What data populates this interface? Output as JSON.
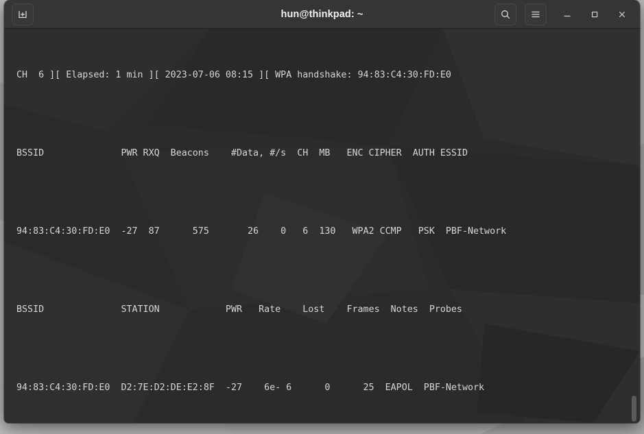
{
  "window": {
    "title": "hun@thinkpad: ~",
    "titlebar": {
      "new_tab_label": "new-tab",
      "search_label": "search",
      "menu_label": "menu",
      "minimize_label": "minimize",
      "maximize_label": "maximize",
      "close_label": "close"
    },
    "colors": {
      "titlebar_bg": "#353535",
      "terminal_bg": "#2b2b2b",
      "terminal_fg": "#d6d6d6",
      "desktop_bg": "#b7b7b7",
      "scrollbar_thumb": "#5a5a5a"
    }
  },
  "terminal": {
    "status_line": {
      "channel_label": "CH",
      "channel": "6",
      "elapsed_label": "Elapsed:",
      "elapsed": "1 min",
      "timestamp": "2023-07-06 08:15",
      "handshake_label": "WPA handshake:",
      "handshake_bssid": "94:83:C4:30:FD:E0",
      "text": "CH  6 ][ Elapsed: 1 min ][ 2023-07-06 08:15 ][ WPA handshake: 94:83:C4:30:FD:E0"
    },
    "ap_table": {
      "header": "BSSID              PWR RXQ  Beacons    #Data, #/s  CH  MB   ENC CIPHER  AUTH ESSID",
      "columns": [
        "BSSID",
        "PWR",
        "RXQ",
        "Beacons",
        "#Data,",
        "#/s",
        "CH",
        "MB",
        "ENC",
        "CIPHER",
        "AUTH",
        "ESSID"
      ],
      "rows": [
        {
          "line": "94:83:C4:30:FD:E0  -27  87      575       26    0   6  130   WPA2 CCMP   PSK  PBF-Network",
          "bssid": "94:83:C4:30:FD:E0",
          "pwr": "-27",
          "rxq": "87",
          "beacons": "575",
          "data": "26",
          "per_sec": "0",
          "ch": "6",
          "mb": "130",
          "enc": "WPA2",
          "cipher": "CCMP",
          "auth": "PSK",
          "essid": "PBF-Network"
        }
      ]
    },
    "station_table": {
      "header": "BSSID              STATION            PWR   Rate    Lost    Frames  Notes  Probes",
      "columns": [
        "BSSID",
        "STATION",
        "PWR",
        "Rate",
        "Lost",
        "Frames",
        "Notes",
        "Probes"
      ],
      "rows": [
        {
          "line": "94:83:C4:30:FD:E0  D2:7E:D2:DE:E2:8F  -27    6e- 6      0      25  EAPOL  PBF-Network",
          "bssid": "94:83:C4:30:FD:E0",
          "station": "D2:7E:D2:DE:E2:8F",
          "pwr": "-27",
          "rate": "6e- 6",
          "lost": "0",
          "frames": "25",
          "notes": "EAPOL",
          "probes": "PBF-Network"
        }
      ]
    }
  }
}
